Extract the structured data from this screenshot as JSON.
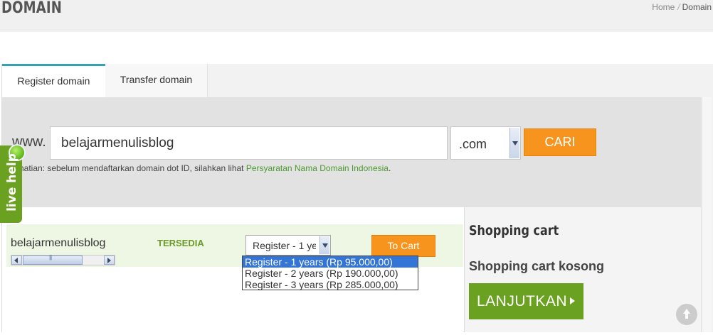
{
  "header": {
    "title": "DOMAIN",
    "breadcrumb": {
      "home": "Home",
      "separator": "/",
      "current": "Domain"
    }
  },
  "tabs": [
    {
      "label": "Register domain",
      "active": true
    },
    {
      "label": "Transfer domain",
      "active": false
    }
  ],
  "search": {
    "prefix": "www.",
    "domain_value": "belajarmenulisblog",
    "tld_selected": ".com",
    "submit_label": "CARI",
    "notice_text": "rhatian: sebelum mendaftarkan domain dot ID, silahkan lihat ",
    "notice_link": "Persyaratan Nama Domain Indonesia",
    "notice_end": "."
  },
  "result": {
    "domain": "belajarmenulisblog",
    "status": "TERSEDIA",
    "period_selected": "Register - 1 years (Rp 95.000,00)",
    "period_options": [
      "Register - 1 years (Rp 95.000,00)",
      "Register - 2 years (Rp 190.000,00)",
      "Register - 3 years (Rp 285.000,00)"
    ],
    "cart_button_label": "To Cart"
  },
  "cart": {
    "title": "Shopping cart",
    "empty_message": "Shopping cart kosong",
    "continue_label": "LANJUTKAN"
  },
  "live_help": {
    "label": "live help"
  },
  "colors": {
    "accent_orange": "#f7941d",
    "accent_green": "#6aa121",
    "status_green": "#6b9a2a",
    "tab_indicator": "#3ba0b4",
    "link_green": "#4a9a2e",
    "selected_blue": "#3375d6"
  }
}
